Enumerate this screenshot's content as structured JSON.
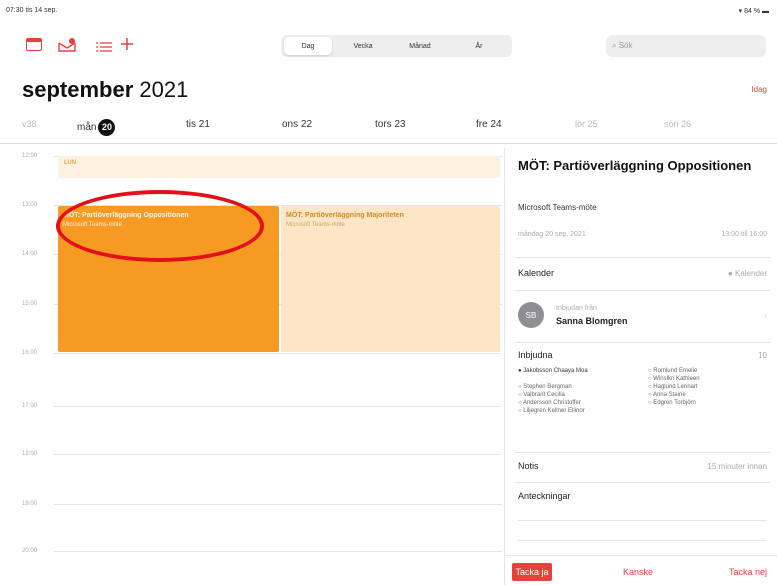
{
  "status": {
    "time_date": "07:30 tis 14 sep.",
    "battery": "▾ 84 % ▬"
  },
  "toolbar": {
    "icons": [
      "calendar-list-icon",
      "inbox-icon",
      "list-icon",
      "add-icon"
    ],
    "views": [
      "Dag",
      "Vecka",
      "Månad",
      "År"
    ],
    "active_view": "Dag",
    "search_placeholder": "⌕ Sök"
  },
  "header": {
    "month": "september",
    "year": "2021",
    "today_button": "Idag"
  },
  "week": {
    "week_label": "v38",
    "days": [
      {
        "name": "mån",
        "num": "20",
        "selected": true
      },
      {
        "name": "tis 21"
      },
      {
        "name": "ons 22"
      },
      {
        "name": "tors 23"
      },
      {
        "name": "fre 24"
      },
      {
        "name": "lör 25",
        "dim": true
      },
      {
        "name": "sön 26",
        "dim": true
      }
    ]
  },
  "hours": [
    "12:00",
    "13:00",
    "14:00",
    "15:00",
    "16:00",
    "17:00",
    "18:00",
    "19:00",
    "20:00"
  ],
  "allday_event": {
    "title": "LUN"
  },
  "events": [
    {
      "title": "MÖT: Partiöverläggning Oppositionen",
      "subtitle": "Microsoft Teams-möte"
    },
    {
      "title": "MÖT: Partiöverläggning Majoriteten",
      "subtitle": "Microsoft Teams-möte"
    }
  ],
  "detail": {
    "title": "MÖT: Partiöverläggning Oppositionen",
    "subtitle": "Microsoft Teams-möte",
    "date": "måndag 20 sep. 2021",
    "time": "13:00 till 16:00",
    "calendar_label": "Kalender",
    "calendar_value": "● Kalender",
    "invited_from_label": "Inbjudan från",
    "invited_from_name": "Sanna Blomgren",
    "avatar_initials": "SB",
    "invited_label": "Inbjudna",
    "invited_count": "10",
    "invitees_left": [
      "● Jakobsson Chaaya Moa",
      "",
      "○ Stephen Bergman",
      "○ Valbrant Cecilia",
      "○ Andersson Christoffer",
      "○ Liljegren Kellner Ellinor"
    ],
    "invitees_right": [
      "○ Romlund Emelie",
      "○ Winslkn Kathleen",
      "○ Haglund Lennart",
      "○ Anna Staine",
      "○ Edgren Torbjörn"
    ],
    "notis_label": "Notis",
    "notis_value": "15 minuter innan",
    "notes_label": "Anteckningar",
    "accept": "Tacka ja",
    "maybe": "Kanske",
    "decline": "Tacka nej"
  }
}
